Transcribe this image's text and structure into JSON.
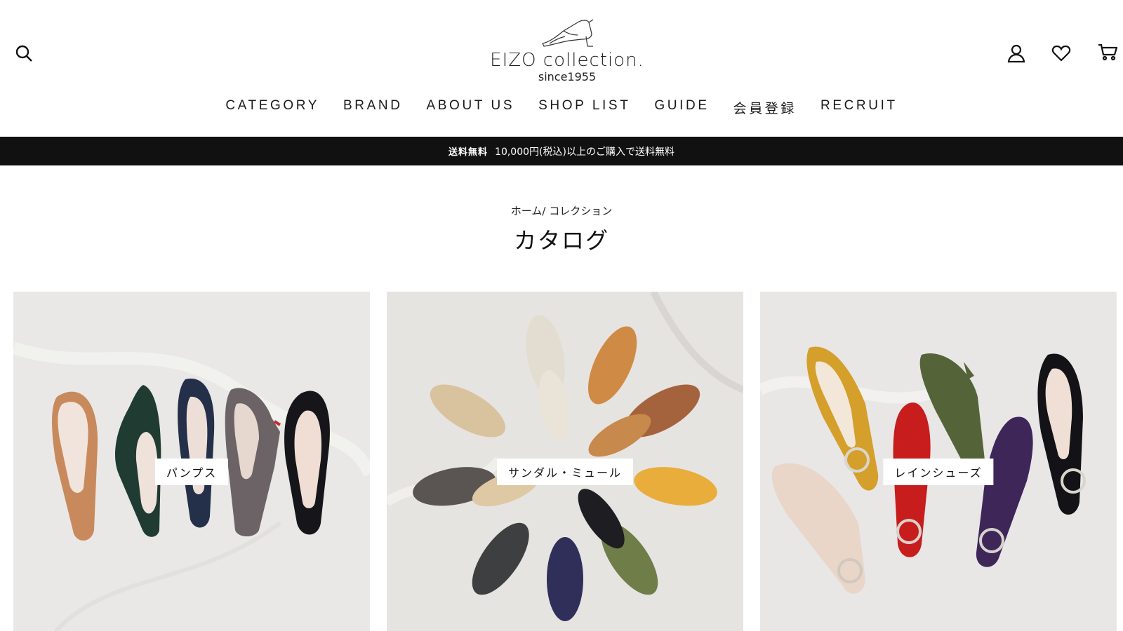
{
  "header": {
    "logo_name": "EIZO collection.",
    "logo_since": "since1955",
    "icons": [
      "search-icon",
      "user-icon",
      "heart-icon",
      "cart-icon"
    ]
  },
  "nav": {
    "items": [
      {
        "label": "CATEGORY"
      },
      {
        "label": "BRAND"
      },
      {
        "label": "ABOUT US"
      },
      {
        "label": "SHOP LIST"
      },
      {
        "label": "GUIDE"
      },
      {
        "label": "会員登録"
      },
      {
        "label": "RECRUIT"
      }
    ]
  },
  "announcement": {
    "tag": "送料無料",
    "text": "10,000円(税込)以上のご購入で送料無料"
  },
  "breadcrumb": {
    "home": "ホーム",
    "separator": "/ ",
    "current": "コレクション"
  },
  "page_title": "カタログ",
  "collections": [
    {
      "label": "パンプス"
    },
    {
      "label": "サンダル・ミュール"
    },
    {
      "label": "レインシューズ"
    }
  ],
  "colors": {
    "announcement_bg": "#111111",
    "text": "#111111",
    "background": "#ffffff"
  }
}
